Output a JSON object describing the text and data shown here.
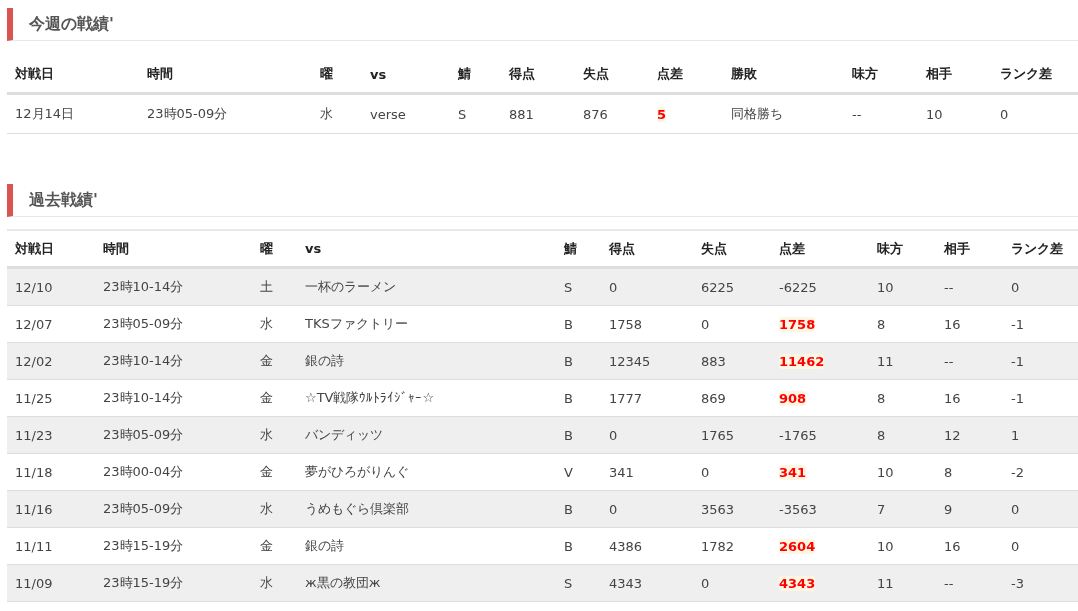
{
  "this_week": {
    "title": "今週の戦績'",
    "columns": [
      "対戦日",
      "時間",
      "曜",
      "vs",
      "鯖",
      "得点",
      "失点",
      "点差",
      "勝敗",
      "味方",
      "相手",
      "ランク差"
    ],
    "rows": [
      {
        "date": "12月14日",
        "time": "23時05-09分",
        "day": "水",
        "vs": "verse",
        "server": "S",
        "score": "881",
        "conceded": "876",
        "diff": "5",
        "diff_highlight": true,
        "result": "同格勝ち",
        "ally": "--",
        "opponent": "10",
        "rank_diff": "0"
      }
    ]
  },
  "past": {
    "title": "過去戦績'",
    "columns": [
      "対戦日",
      "時間",
      "曜",
      "vs",
      "鯖",
      "得点",
      "失点",
      "点差",
      "味方",
      "相手",
      "ランク差"
    ],
    "rows": [
      {
        "date": "12/10",
        "time": "23時10-14分",
        "day": "土",
        "vs": "一杯のラーメン",
        "server": "S",
        "score": "0",
        "conceded": "6225",
        "diff": "-6225",
        "diff_highlight": false,
        "ally": "10",
        "opponent": "--",
        "rank_diff": "0"
      },
      {
        "date": "12/07",
        "time": "23時05-09分",
        "day": "水",
        "vs": "TKSファクトリー",
        "server": "B",
        "score": "1758",
        "conceded": "0",
        "diff": "1758",
        "diff_highlight": true,
        "ally": "8",
        "opponent": "16",
        "rank_diff": "-1"
      },
      {
        "date": "12/02",
        "time": "23時10-14分",
        "day": "金",
        "vs": "銀の詩",
        "server": "B",
        "score": "12345",
        "conceded": "883",
        "diff": "11462",
        "diff_highlight": true,
        "ally": "11",
        "opponent": "--",
        "rank_diff": "-1"
      },
      {
        "date": "11/25",
        "time": "23時10-14分",
        "day": "金",
        "vs": "☆TV戦隊ｳﾙﾄﾗｲｼﾞｬｰ☆",
        "server": "B",
        "score": "1777",
        "conceded": "869",
        "diff": "908",
        "diff_highlight": true,
        "ally": "8",
        "opponent": "16",
        "rank_diff": "-1"
      },
      {
        "date": "11/23",
        "time": "23時05-09分",
        "day": "水",
        "vs": "バンディッツ",
        "server": "B",
        "score": "0",
        "conceded": "1765",
        "diff": "-1765",
        "diff_highlight": false,
        "ally": "8",
        "opponent": "12",
        "rank_diff": "1"
      },
      {
        "date": "11/18",
        "time": "23時00-04分",
        "day": "金",
        "vs": "夢がひろがりんぐ",
        "server": "V",
        "score": "341",
        "conceded": "0",
        "diff": "341",
        "diff_highlight": true,
        "ally": "10",
        "opponent": "8",
        "rank_diff": "-2"
      },
      {
        "date": "11/16",
        "time": "23時05-09分",
        "day": "水",
        "vs": "うめもぐら倶楽部",
        "server": "B",
        "score": "0",
        "conceded": "3563",
        "diff": "-3563",
        "diff_highlight": false,
        "ally": "7",
        "opponent": "9",
        "rank_diff": "0"
      },
      {
        "date": "11/11",
        "time": "23時15-19分",
        "day": "金",
        "vs": "銀の詩",
        "server": "B",
        "score": "4386",
        "conceded": "1782",
        "diff": "2604",
        "diff_highlight": true,
        "ally": "10",
        "opponent": "16",
        "rank_diff": "0"
      },
      {
        "date": "11/09",
        "time": "23時15-19分",
        "day": "水",
        "vs": "ж黒の教団ж",
        "server": "S",
        "score": "4343",
        "conceded": "0",
        "diff": "4343",
        "diff_highlight": true,
        "ally": "11",
        "opponent": "--",
        "rank_diff": "-3"
      }
    ]
  }
}
